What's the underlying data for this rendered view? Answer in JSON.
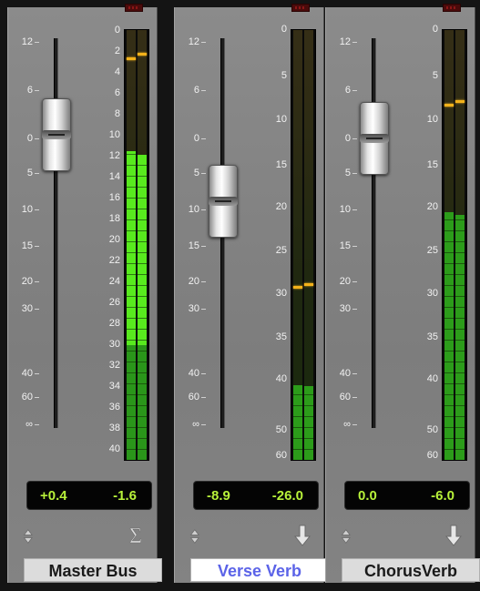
{
  "scale_fader": [
    "12",
    "6",
    "0",
    "5",
    "10",
    "15",
    "20",
    "30",
    "40",
    "60",
    "∞"
  ],
  "scale_master": [
    "0",
    "2",
    "4",
    "6",
    "8",
    "10",
    "12",
    "14",
    "16",
    "18",
    "20",
    "22",
    "24",
    "26",
    "28",
    "30",
    "32",
    "34",
    "36",
    "38",
    "40"
  ],
  "scale_aux": [
    "0",
    "5",
    "10",
    "15",
    "20",
    "25",
    "30",
    "35",
    "40",
    "50",
    "60"
  ],
  "channels": [
    {
      "name": "Master Bus",
      "selected": false,
      "volume_readout": "+0.4",
      "peak_readout": "-1.6",
      "fader_db": 0.4,
      "meter_left_db": -11.5,
      "meter_right_db": -11.8,
      "meter_hot_floor_db": -30,
      "peak_left_db": -2.6,
      "peak_right_db": -2.2,
      "right_icon": "sigma-icon"
    },
    {
      "name": "Verse Verb",
      "selected": true,
      "volume_readout": "-8.9",
      "peak_readout": "-26.0",
      "fader_db": -8.9,
      "meter_left_db": -41.0,
      "meter_right_db": -41.2,
      "peak_left_db": -29.2,
      "peak_right_db": -28.8,
      "right_icon": "arrow-down-icon"
    },
    {
      "name": "ChorusVerb",
      "selected": false,
      "volume_readout": "0.0",
      "peak_readout": "-6.0",
      "fader_db": 0.0,
      "meter_left_db": -20.5,
      "meter_right_db": -20.8,
      "peak_left_db": -8.2,
      "peak_right_db": -7.8,
      "right_icon": "arrow-down-icon"
    }
  ],
  "colors": {
    "meter_green": "#2c9c1a",
    "meter_bright_green": "#58ea1e",
    "peak_hold": "#f3b21b",
    "readout_text": "#b8f23a",
    "selected_name": "#5b63e8"
  }
}
